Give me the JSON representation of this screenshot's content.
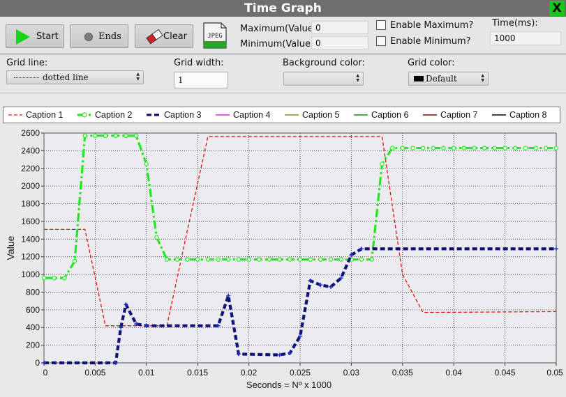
{
  "window": {
    "title": "Time Graph",
    "close_label": "X"
  },
  "toolbar": {
    "start_label": "Start",
    "ends_label": "Ends",
    "clear_label": "Clear",
    "jpeg_label": "JPEG",
    "maximum_label": "Maximum(Value):",
    "maximum_value": "0",
    "minimum_label": "Minimum(Value):",
    "minimum_value": "0",
    "enable_max_label": "Enable Maximum?",
    "enable_min_label": "Enable Minimum?",
    "time_label": "Time(ms):",
    "time_value": "1000"
  },
  "options": {
    "grid_line_label": "Grid line:",
    "grid_line_value": "dotted line",
    "grid_width_label": "Grid width:",
    "grid_width_value": "1",
    "bg_color_label": "Background color:",
    "bg_color_value": "",
    "grid_color_label": "Grid color:",
    "grid_color_value": "Default"
  },
  "colors": {
    "plot_bg": "#ebebf0",
    "caption1": "#e01010",
    "caption2": "#22e822",
    "caption3": "#111177",
    "caption4": "#e020e0",
    "caption5": "#8a8a14",
    "caption6": "#118811",
    "caption7": "#880000",
    "caption8": "#000000"
  },
  "chart_data": {
    "type": "line",
    "title": "",
    "xlabel": "Seconds = Nº x 1000",
    "ylabel": "Value",
    "xlim": [
      0,
      0.05
    ],
    "ylim": [
      0,
      2600
    ],
    "x_ticks": [
      "0",
      "0.005",
      "0.01",
      "0.015",
      "0.02",
      "0.025",
      "0.03",
      "0.035",
      "0.04",
      "0.045",
      "0.05"
    ],
    "y_ticks": [
      "0",
      "200",
      "400",
      "600",
      "800",
      "1000",
      "1200",
      "1400",
      "1600",
      "1800",
      "2000",
      "2200",
      "2400",
      "2600"
    ],
    "grid": "dotted",
    "legend_position": "top",
    "legend": [
      "Caption 1",
      "Caption 2",
      "Caption 3",
      "Caption 4",
      "Caption 5",
      "Caption 6",
      "Caption 7",
      "Caption 8"
    ],
    "series": [
      {
        "name": "Caption 1",
        "style": "dashed",
        "points": [
          [
            0,
            1510
          ],
          [
            0.004,
            1510
          ],
          [
            0.006,
            420
          ],
          [
            0.012,
            420
          ],
          [
            0.014,
            1500
          ],
          [
            0.016,
            2560
          ],
          [
            0.033,
            2560
          ],
          [
            0.035,
            1000
          ],
          [
            0.037,
            570
          ],
          [
            0.05,
            580
          ]
        ]
      },
      {
        "name": "Caption 2",
        "style": "dash-dot-marker",
        "points": [
          [
            0,
            960
          ],
          [
            0.002,
            960
          ],
          [
            0.003,
            1150
          ],
          [
            0.004,
            2570
          ],
          [
            0.009,
            2570
          ],
          [
            0.01,
            2250
          ],
          [
            0.011,
            1420
          ],
          [
            0.012,
            1170
          ],
          [
            0.013,
            1170
          ],
          [
            0.032,
            1170
          ],
          [
            0.033,
            2250
          ],
          [
            0.034,
            2430
          ],
          [
            0.05,
            2430
          ]
        ]
      },
      {
        "name": "Caption 3",
        "style": "thick-dashed",
        "points": [
          [
            0,
            0
          ],
          [
            0.007,
            0
          ],
          [
            0.0075,
            400
          ],
          [
            0.008,
            660
          ],
          [
            0.009,
            440
          ],
          [
            0.01,
            420
          ],
          [
            0.017,
            420
          ],
          [
            0.018,
            760
          ],
          [
            0.019,
            100
          ],
          [
            0.023,
            90
          ],
          [
            0.024,
            110
          ],
          [
            0.025,
            300
          ],
          [
            0.026,
            930
          ],
          [
            0.027,
            880
          ],
          [
            0.028,
            860
          ],
          [
            0.029,
            960
          ],
          [
            0.03,
            1220
          ],
          [
            0.031,
            1290
          ],
          [
            0.05,
            1290
          ]
        ]
      },
      {
        "name": "Caption 4",
        "points": []
      },
      {
        "name": "Caption 5",
        "points": []
      },
      {
        "name": "Caption 6",
        "points": []
      },
      {
        "name": "Caption 7",
        "points": []
      },
      {
        "name": "Caption 8",
        "points": []
      }
    ]
  }
}
